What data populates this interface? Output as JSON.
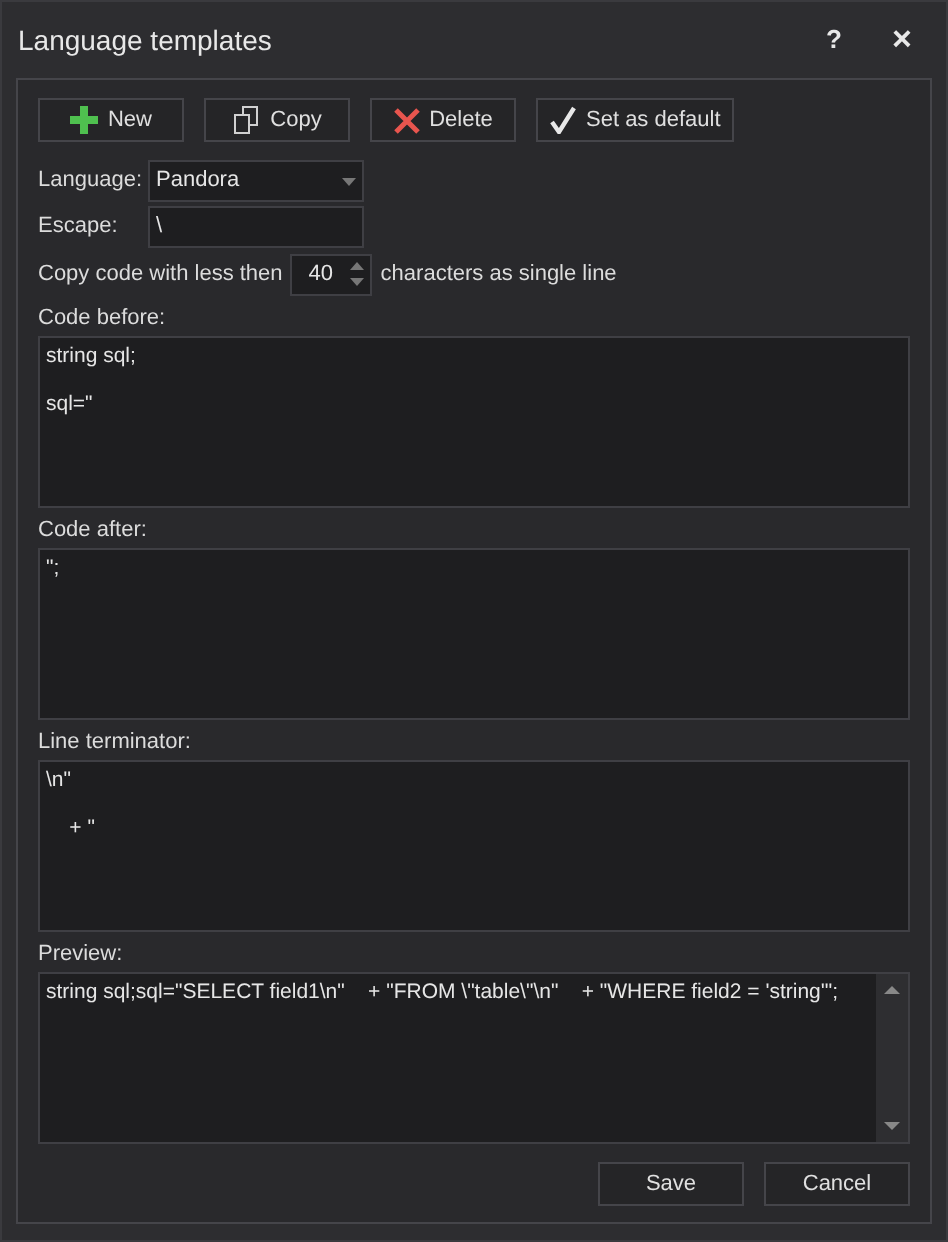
{
  "window": {
    "title": "Language templates",
    "help": "?",
    "close": "×"
  },
  "toolbar": [
    {
      "kind": "new",
      "label": "New"
    },
    {
      "kind": "copy",
      "label": "Copy"
    },
    {
      "kind": "delete",
      "label": "Delete"
    },
    {
      "kind": "default",
      "label": "Set as default"
    }
  ],
  "language": {
    "label": "Language:",
    "value": "Pandora"
  },
  "escape": {
    "label": "Escape:",
    "value": "\\"
  },
  "single_line": {
    "label_before": "Copy code with less then",
    "value": "40",
    "label_after": "characters as single line"
  },
  "sections": [
    {
      "label": "Code before:",
      "text": "string sql;\n\nsql=\""
    },
    {
      "label": "Code after:",
      "text": "\";"
    },
    {
      "label": "Line terminator:",
      "text": "\\n\"\n\n    + \""
    },
    {
      "label": "Preview:",
      "text": "string sql;sql=\"SELECT field1\\n\"    + \"FROM \\\"table\\\"\\n\"    + \"WHERE field2 = 'string'\";",
      "scrollbar": true
    }
  ],
  "buttons": [
    "Save",
    "Cancel"
  ]
}
